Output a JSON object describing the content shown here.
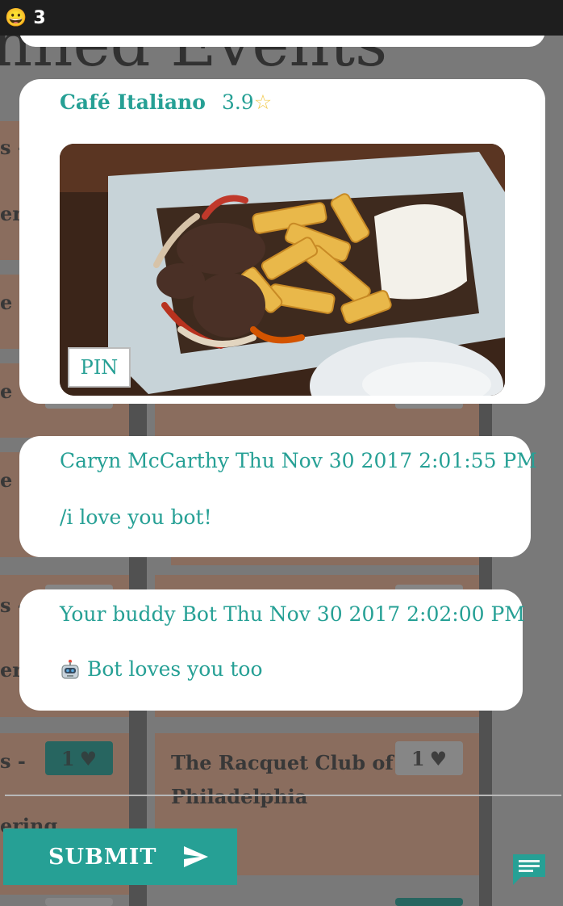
{
  "top_bar": {
    "count": "3"
  },
  "background": {
    "title_fragment": "nned Events",
    "venue_name_line1": "The Racquet Club of",
    "venue_name_line2": "Philadelphia",
    "heart_count": "1",
    "left_frag_1": "s -",
    "left_frag_2": "eri",
    "left_frag_3": "e",
    "left_frag_4": "ering"
  },
  "restaurant_card": {
    "name": "Café Italiano",
    "rating": "3.9",
    "pin_label": "PIN"
  },
  "messages": [
    {
      "header": "Caryn McCarthy Thu Nov 30 2017 2:01:55 PM",
      "body": "/i love you bot!"
    },
    {
      "header": "Your buddy Bot Thu Nov 30 2017 2:02:00 PM",
      "body": "Bot loves you too"
    }
  ],
  "submit": {
    "label": "SUBMIT"
  },
  "colors": {
    "accent": "#26a095",
    "card": "#ffffff",
    "top_bar": "#1e1e1e"
  }
}
